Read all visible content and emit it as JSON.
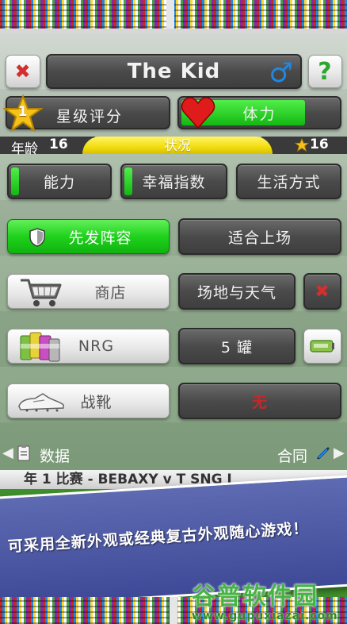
{
  "header": {
    "player_name": "The Kid",
    "gender_symbol": "♂",
    "help_label": "?",
    "close_label": "✖"
  },
  "stats": {
    "star_level": "1",
    "star_rating_label": "星级评分",
    "stamina_label": "体力",
    "stamina_fill": 0.8
  },
  "age_strip": {
    "age_label": "年龄",
    "age_value": "16",
    "status_label": "状况",
    "star_value": "16"
  },
  "tabs": [
    {
      "label": "能力",
      "fill": 0.08
    },
    {
      "label": "幸福指数",
      "fill": 0.08
    },
    {
      "label": "生活方式",
      "fill": 0
    }
  ],
  "lineup": {
    "starting_label": "先发阵容",
    "fit_label": "适合上场"
  },
  "shop": {
    "shop_label": "商店",
    "venue_weather_label": "场地与天气",
    "cancel_label": "✖"
  },
  "nrg": {
    "label": "NRG",
    "count_label": "5 罐"
  },
  "boots": {
    "label": "战靴",
    "value": "无"
  },
  "footer": {
    "data_label": "数据",
    "contract_label": "合同"
  },
  "ticker": {
    "text": "年 1     比赛 - BEBAXY v T SNG I"
  },
  "banner": {
    "text": "可采用全新外观或经典复古外观随心游戏！"
  },
  "watermark": {
    "title": "谷普软件园",
    "url": "www.gupuxiazai.com"
  },
  "colors": {
    "accent_green": "#1fd11c",
    "close_red": "#d32f2f",
    "gender_blue": "#1e88e5",
    "status_yellow": "#f2dd0f",
    "boots_value_red": "#c62828"
  }
}
